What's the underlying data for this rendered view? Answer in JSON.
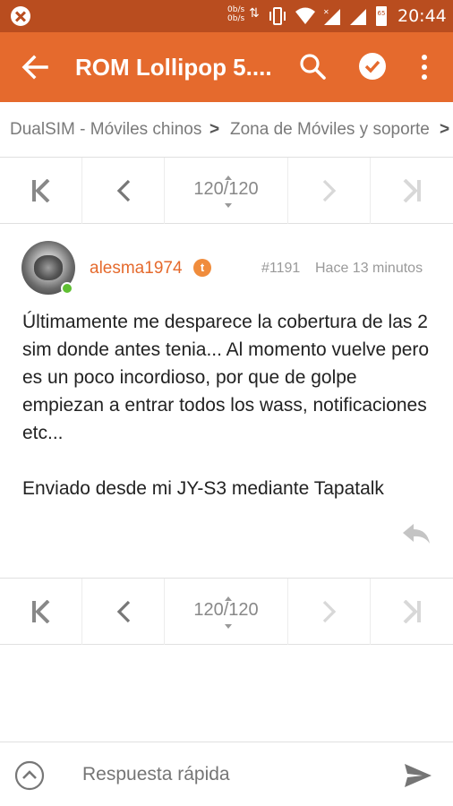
{
  "status_bar": {
    "speed_up": "0b/s",
    "speed_down": "0b/s",
    "transfer_arrows": "⇅",
    "battery_level": "65",
    "time": "20:44",
    "icons": [
      "app-notification-icon",
      "data-transfer-icon",
      "vibrate-icon",
      "wifi-icon",
      "signal-sim1-icon",
      "signal-sim2-icon",
      "battery-icon"
    ]
  },
  "app_bar": {
    "title": "ROM Lollipop 5....",
    "color": "#e56a2d",
    "icons": [
      "back-arrow-icon",
      "search-icon",
      "check-circle-icon",
      "more-vert-icon"
    ]
  },
  "breadcrumb": {
    "items": [
      "DualSIM - Móviles chinos",
      "Zona de Móviles y soporte"
    ],
    "separator": ">"
  },
  "pager": {
    "current_page": "120",
    "total_pages": "120",
    "label": "120/120",
    "icons": [
      "first-page-icon",
      "previous-page-icon",
      "next-page-icon",
      "last-page-icon"
    ]
  },
  "post": {
    "username": "alesma1974",
    "badge": "t",
    "post_number": "#1191",
    "time_ago": "Hace 13 minutos",
    "online": true,
    "body": "Últimamente me desparece la cobertura de las 2 sim donde antes tenia... Al momento vuelve pero es un poco incordioso, por que de golpe empiezan a entrar todos los wass, notificaciones etc...",
    "signature": "Enviado desde mi JY-S3 mediante Tapatalk",
    "reply_icon": "reply-icon"
  },
  "reply_bar": {
    "placeholder": "Respuesta rápida",
    "icons": [
      "expand-up-icon",
      "send-icon"
    ]
  }
}
